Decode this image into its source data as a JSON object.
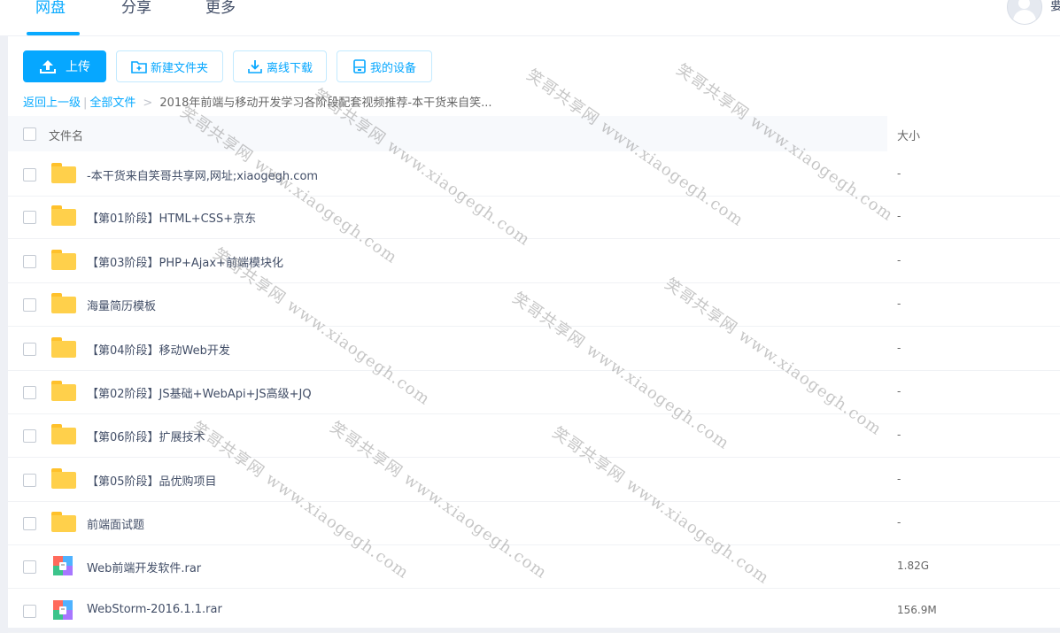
{
  "nav": {
    "tabs": [
      {
        "label": "网盘",
        "active": true
      },
      {
        "label": "分享",
        "active": false
      },
      {
        "label": "更多",
        "active": false
      }
    ],
    "user_initial": "要"
  },
  "toolbar": {
    "upload": "上传",
    "new_folder": "新建文件夹",
    "offline_download": "离线下载",
    "my_devices": "我的设备"
  },
  "breadcrumb": {
    "back": "返回上一级",
    "separator": "|",
    "all_files": "全部文件",
    "arrow": ">",
    "current": "2018年前端与移动开发学习各阶段配套视频推荐-本干货来自笑..."
  },
  "table": {
    "headers": {
      "name": "文件名",
      "size": "大小"
    },
    "rows": [
      {
        "name": "-本干货来自笑哥共享网,网址;xiaogegh.com",
        "size": "-",
        "type": "folder"
      },
      {
        "name": "【第01阶段】HTML+CSS+京东",
        "size": "-",
        "type": "folder"
      },
      {
        "name": "【第03阶段】PHP+Ajax+前端模块化",
        "size": "-",
        "type": "folder"
      },
      {
        "name": "海量简历模板",
        "size": "-",
        "type": "folder"
      },
      {
        "name": "【第04阶段】移动Web开发",
        "size": "-",
        "type": "folder"
      },
      {
        "name": "【第02阶段】JS基础+WebApi+JS高级+JQ",
        "size": "-",
        "type": "folder"
      },
      {
        "name": "【第06阶段】扩展技术",
        "size": "-",
        "type": "folder"
      },
      {
        "name": "【第05阶段】品优购项目",
        "size": "-",
        "type": "folder"
      },
      {
        "name": "前端面试题",
        "size": "-",
        "type": "folder"
      },
      {
        "name": "Web前端开发软件.rar",
        "size": "1.82G",
        "type": "archive"
      },
      {
        "name": "WebStorm-2016.1.1.rar",
        "size": "156.9M",
        "type": "archive"
      }
    ]
  },
  "watermark": "笑哥共享网 www.xiaogegh.com",
  "colors": {
    "accent": "#06a7ff",
    "folder": "#ffd04b",
    "text": "#424e67",
    "background": "#eef0f5"
  },
  "icons": {
    "upload": "upload-icon",
    "new_folder": "folder-plus-icon",
    "offline_download": "download-icon",
    "my_devices": "device-icon",
    "folder": "folder-icon",
    "archive": "archive-icon"
  }
}
